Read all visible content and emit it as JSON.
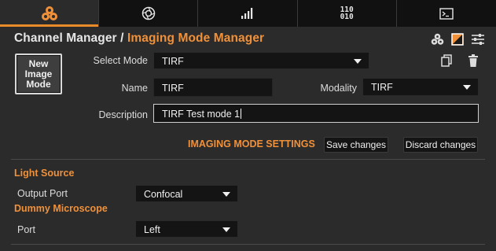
{
  "tabs": [
    {
      "icon": "channels-icon",
      "active": true
    },
    {
      "icon": "aperture-icon",
      "active": false
    },
    {
      "icon": "bar-chart-icon",
      "active": false
    },
    {
      "icon": "binary-icon",
      "label": "110\n010",
      "active": false
    },
    {
      "icon": "terminal-icon",
      "active": false
    }
  ],
  "header": {
    "crumb_root": "Channel Manager",
    "separator": " / ",
    "crumb_current": "Imaging Mode Manager",
    "icons": [
      "channels-icon",
      "color-swatch-icon",
      "sliders-icon"
    ]
  },
  "new_mode_button": "New\nImage\nMode",
  "form": {
    "select_mode_label": "Select Mode",
    "select_mode_value": "TIRF",
    "name_label": "Name",
    "name_value": "TIRF",
    "modality_label": "Modality",
    "modality_value": "TIRF",
    "description_label": "Description",
    "description_value": "TIRF Test mode 1",
    "mode_actions": [
      "copy-icon",
      "trash-icon"
    ]
  },
  "settings": {
    "title": "IMAGING MODE SETTINGS",
    "save_label": "Save changes",
    "discard_label": "Discard changes"
  },
  "sections": [
    {
      "title": "Light Source",
      "field_label": "Output Port",
      "field_value": "Confocal"
    },
    {
      "title": "Dummy Microscope",
      "field_label": "Port",
      "field_value": "Left"
    }
  ],
  "colors": {
    "accent": "#f0913a",
    "background": "#2b2b2b",
    "tabbar": "#111111",
    "field": "#141414"
  }
}
